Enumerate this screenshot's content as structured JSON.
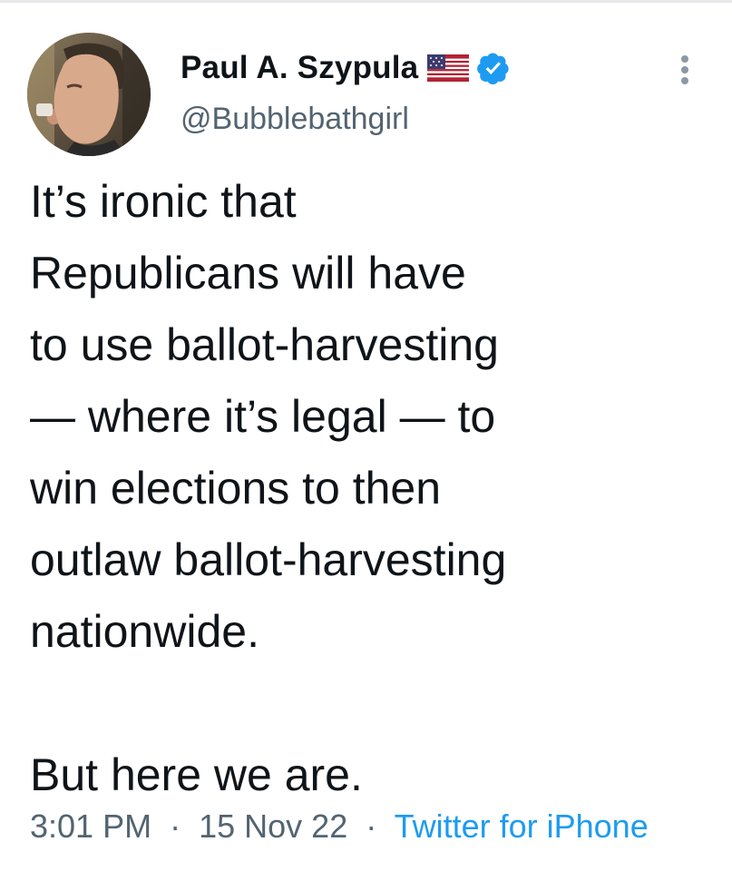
{
  "author": {
    "display_name": "Paul A. Szypula",
    "handle": "@Bubblebathgirl",
    "flag_icon": "us-flag-icon",
    "verified_icon": "verified-badge-icon",
    "verified_color": "#1d9bf0"
  },
  "tweet": {
    "lines": [
      "It’s ironic that",
      "Republicans will have",
      "to use ballot-harvesting",
      "— where it’s legal — to",
      "win elections to then",
      "outlaw ballot-harvesting",
      "nationwide."
    ],
    "closing_line": "But here we are."
  },
  "meta": {
    "time": "3:01 PM",
    "separator": "·",
    "date": "15 Nov 22",
    "source": "Twitter for iPhone",
    "source_color": "#1d9bf0"
  },
  "menu_icon": "more-options-icon"
}
